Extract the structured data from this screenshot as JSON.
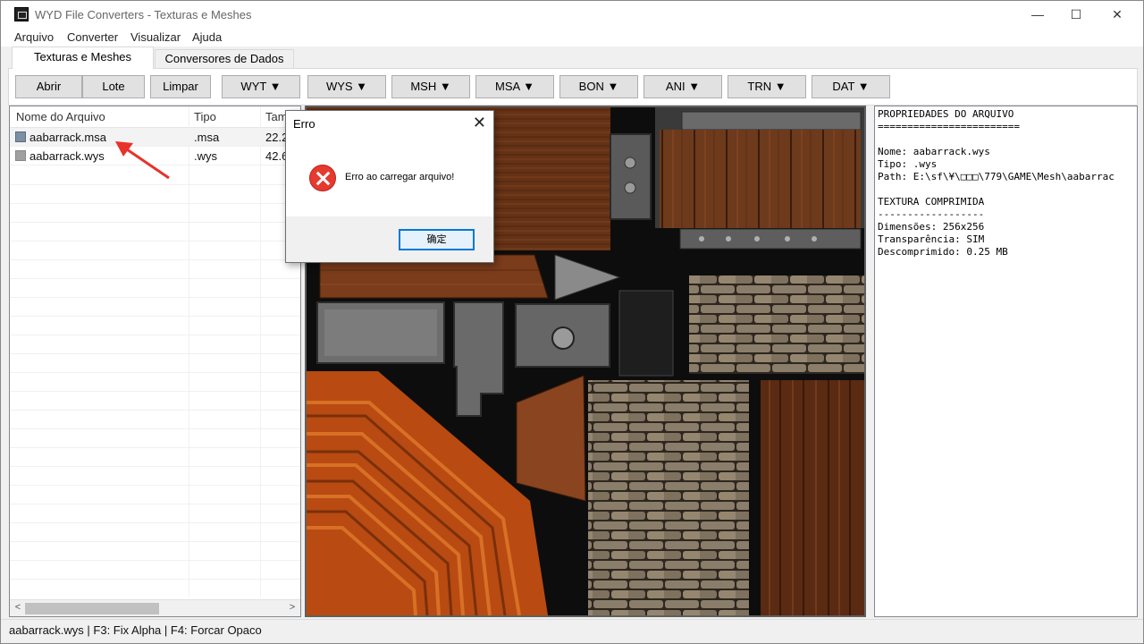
{
  "window": {
    "title": "WYD File Converters - Texturas e Meshes",
    "controls": {
      "minimize": "—",
      "maximize": "☐",
      "close": "✕"
    }
  },
  "menu": [
    "Arquivo",
    "Converter",
    "Visualizar",
    "Ajuda"
  ],
  "tabs": [
    {
      "label": "Texturas e Meshes",
      "active": true
    },
    {
      "label": "Conversores de Dados",
      "active": false
    }
  ],
  "toolbar": {
    "buttons": [
      "Abrir",
      "Lote",
      "Limpar"
    ],
    "dropdowns": [
      "WYT ▼",
      "WYS ▼",
      "MSH ▼",
      "MSA ▼",
      "BON ▼",
      "ANI ▼",
      "TRN ▼",
      "DAT ▼"
    ]
  },
  "file_list": {
    "columns": [
      "Nome do Arquivo",
      "Tipo",
      "Tam"
    ],
    "rows": [
      {
        "name": "aabarrack.msa",
        "type": ".msa",
        "size": "22.2"
      },
      {
        "name": "aabarrack.wys",
        "type": ".wys",
        "size": "42.6"
      }
    ],
    "scroll_left": "<",
    "scroll_right": ">"
  },
  "properties": {
    "text": "PROPRIEDADES DO ARQUIVO\n========================\n\nNome: aabarrack.wys\nTipo: .wys\nPath: E:\\sf\\¥\\□□□\\779\\GAME\\Mesh\\aabarrac\n\nTEXTURA COMPRIMIDA\n------------------\nDimensões: 256x256\nTransparência: SIM\nDescomprimido: 0.25 MB"
  },
  "status_bar": "aabarrack.wys | F3: Fix Alpha | F4: Forcar Opaco",
  "dialog": {
    "title": "Erro",
    "close": "✕",
    "message": "Erro ao carregar arquivo!",
    "ok_label": "确定"
  },
  "colors": {
    "error_red": "#e53a2d",
    "focus_blue": "#0078d7",
    "wood_orange": "#b84a12",
    "wood_brown": "#6b3518",
    "stone": "#8a7d6a",
    "metal": "#7a7a7a",
    "annotation_arrow": "#e8322a"
  }
}
